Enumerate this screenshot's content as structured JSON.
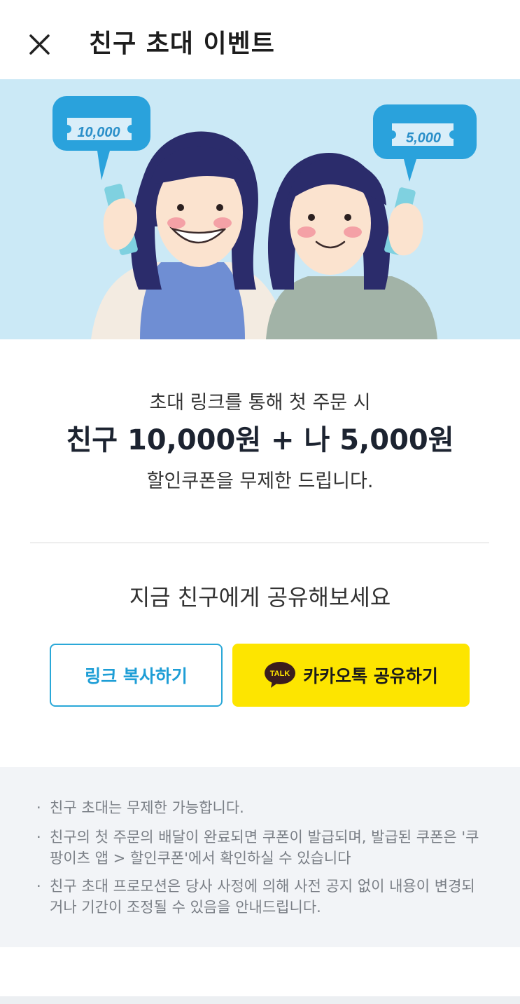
{
  "header": {
    "title": "친구 초대 이벤트",
    "close_icon": "close-icon"
  },
  "banner": {
    "left_ticket": "10,000",
    "right_ticket": "5,000"
  },
  "promo": {
    "line1": "초대 링크를 통해 첫 주문 시",
    "line2": "친구 10,000원 + 나 5,000원",
    "line3": "할인쿠폰을 무제한 드립니다."
  },
  "share": {
    "title": "지금 친구에게 공유해보세요",
    "copy_link_label": "링크 복사하기",
    "kakao_label": "카카오톡 공유하기",
    "kakao_icon_text": "TALK"
  },
  "notices": [
    "친구 초대는 무제한 가능합니다.",
    "친구의 첫 주문의 배달이 완료되면 쿠폰이 발급되며, 발급된 쿠폰은 '쿠팡이츠 앱 > 할인쿠폰'에서 확인하실 수 있습니다",
    "친구 초대 프로모션은 당사 사정에 의해 사전 공지 없이 내용이 변경되거나 기간이 조정될 수 있음을 안내드립니다."
  ],
  "colors": {
    "accent_blue": "#1e9ed6",
    "kakao_yellow": "#fde500",
    "banner_bg": "#cbe9f6"
  }
}
